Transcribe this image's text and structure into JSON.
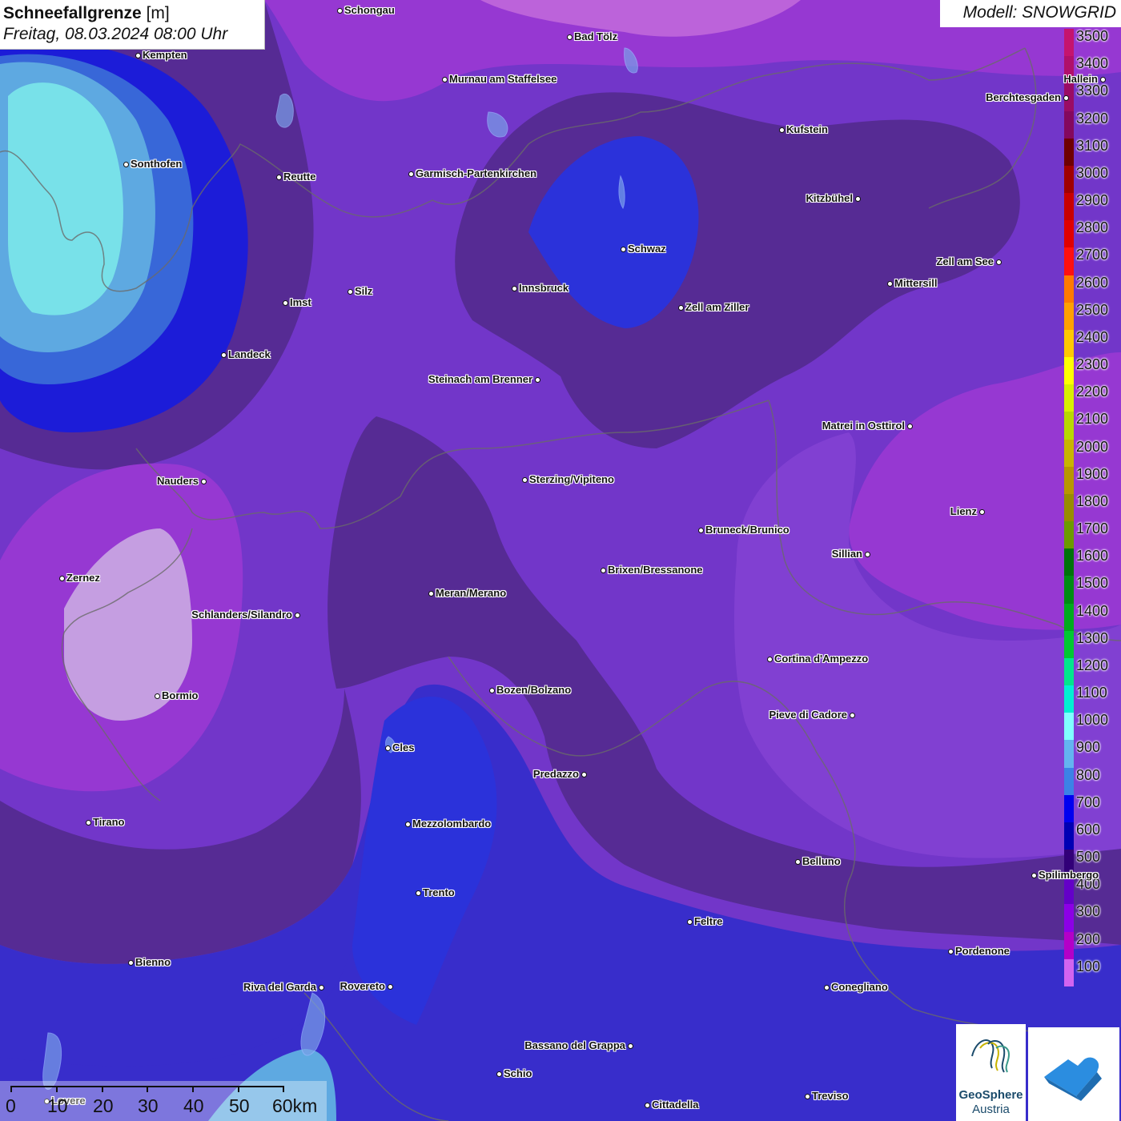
{
  "title": {
    "variable": "Schneefallgrenze",
    "unit": "[m]",
    "datetime": "Freitag, 08.03.2024 08:00 Uhr"
  },
  "model": "Modell: SNOWGRID",
  "legend": {
    "labels": [
      "3500",
      "3400",
      "3300",
      "3200",
      "3100",
      "3000",
      "2900",
      "2800",
      "2700",
      "2600",
      "2500",
      "2400",
      "2300",
      "2200",
      "2100",
      "2000",
      "1900",
      "1800",
      "1700",
      "1600",
      "1500",
      "1400",
      "1300",
      "1200",
      "1100",
      "1000",
      "900",
      "800",
      "700",
      "600",
      "500",
      "400",
      "300",
      "200",
      "100"
    ],
    "colors": [
      "#c5146e",
      "#b0106a",
      "#9a0c64",
      "#84085e",
      "#6e0000",
      "#a00000",
      "#c80000",
      "#e00000",
      "#ff1010",
      "#ff7a00",
      "#ffa000",
      "#ffc800",
      "#ffff00",
      "#d8f000",
      "#b8d800",
      "#c8b400",
      "#b89600",
      "#988c00",
      "#6c9a00",
      "#00720a",
      "#008c14",
      "#00aa1e",
      "#00c832",
      "#00e68c",
      "#00f0d2",
      "#80ffff",
      "#64b4f0",
      "#3c82e6",
      "#0000f0",
      "#0000b4",
      "#320078",
      "#6400c8",
      "#8c00e6",
      "#b400c8",
      "#d264f0"
    ]
  },
  "cities": [
    {
      "name": "Schongau"
    },
    {
      "name": "Bad Tölz"
    },
    {
      "name": "Kempten"
    },
    {
      "name": "Murnau am Staffelsee"
    },
    {
      "name": "Hallein"
    },
    {
      "name": "Berchtesgaden"
    },
    {
      "name": "Kufstein"
    },
    {
      "name": "Sonthofen"
    },
    {
      "name": "Reutte"
    },
    {
      "name": "Garmisch-Partenkirchen"
    },
    {
      "name": "Kitzbühel"
    },
    {
      "name": "Schwaz"
    },
    {
      "name": "Zell am See"
    },
    {
      "name": "Mittersill"
    },
    {
      "name": "Innsbruck"
    },
    {
      "name": "Silz"
    },
    {
      "name": "Imst"
    },
    {
      "name": "Zell am Ziller"
    },
    {
      "name": "Landeck"
    },
    {
      "name": "Steinach am Brenner"
    },
    {
      "name": "Matrei in Osttirol"
    },
    {
      "name": "Nauders"
    },
    {
      "name": "Sterzing/Vipiteno"
    },
    {
      "name": "Lienz"
    },
    {
      "name": "Bruneck/Brunico"
    },
    {
      "name": "Sillian"
    },
    {
      "name": "Zernez"
    },
    {
      "name": "Brixen/Bressanone"
    },
    {
      "name": "Meran/Merano"
    },
    {
      "name": "Schlanders/Silandro"
    },
    {
      "name": "Cortina d'Ampezzo"
    },
    {
      "name": "Bozen/Bolzano"
    },
    {
      "name": "Bormio"
    },
    {
      "name": "Pieve di Cadore"
    },
    {
      "name": "Cles"
    },
    {
      "name": "Predazzo"
    },
    {
      "name": "Tirano"
    },
    {
      "name": "Mezzolombardo"
    },
    {
      "name": "Belluno"
    },
    {
      "name": "Spilimbergo"
    },
    {
      "name": "Trento"
    },
    {
      "name": "Feltre"
    },
    {
      "name": "Pordenone"
    },
    {
      "name": "Bienno"
    },
    {
      "name": "Riva del Garda"
    },
    {
      "name": "Rovereto"
    },
    {
      "name": "Conegliano"
    },
    {
      "name": "Bassano del Grappa"
    },
    {
      "name": "Schio"
    },
    {
      "name": "Treviso"
    },
    {
      "name": "Cittadella"
    },
    {
      "name": "Lovere"
    }
  ],
  "scale": {
    "labels": [
      "0",
      "10",
      "20",
      "30",
      "40",
      "50",
      "60km"
    ]
  },
  "logos": {
    "geosphere_line1": "GeoSphere",
    "geosphere_line2": "Austria"
  }
}
